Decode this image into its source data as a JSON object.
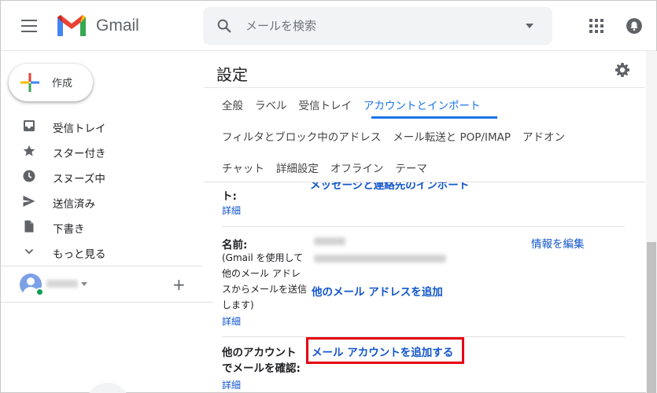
{
  "header": {
    "logo_text": "Gmail",
    "search_placeholder": "メールを検索"
  },
  "sidebar": {
    "compose_label": "作成",
    "items": [
      {
        "label": "受信トレイ",
        "icon": "inbox-icon"
      },
      {
        "label": "スター付き",
        "icon": "star-icon"
      },
      {
        "label": "スヌーズ中",
        "icon": "clock-icon"
      },
      {
        "label": "送信済み",
        "icon": "send-icon"
      },
      {
        "label": "下書き",
        "icon": "draft-icon"
      },
      {
        "label": "もっと見る",
        "icon": "chevron-down-icon"
      }
    ],
    "add_plus": "+"
  },
  "main": {
    "title": "設定",
    "tabs_row1": [
      "全般",
      "ラベル",
      "受信トレイ",
      "アカウントとインポート"
    ],
    "tabs_row2": [
      "フィルタとブロック中のアドレス",
      "メール転送と POP/IMAP",
      "アドオン"
    ],
    "tabs_row3": [
      "チャット",
      "詳細設定",
      "オフライン",
      "テーマ"
    ],
    "active_tab": "アカウントとインポート",
    "partial_heading": "ト:",
    "partial_link": "メッセージと連絡先のインポート",
    "detail_link": "詳細",
    "name_section": {
      "label": "名前:",
      "description": [
        "(Gmail を使用して",
        "他のメール アドレ",
        "スからメールを送信",
        "します)"
      ],
      "edit_link": "情報を編集",
      "add_address_link": "他のメール アドレスを追加",
      "detail_link": "詳細"
    },
    "check_mail_section": {
      "label_lines": [
        "他のアカウント",
        "でメールを確認:"
      ],
      "add_account_link": "メール アカウントを追加する",
      "detail_link": "詳細"
    }
  },
  "colors": {
    "accent": "#1a73e8",
    "link": "#1155cc",
    "highlight": "#e60012"
  }
}
